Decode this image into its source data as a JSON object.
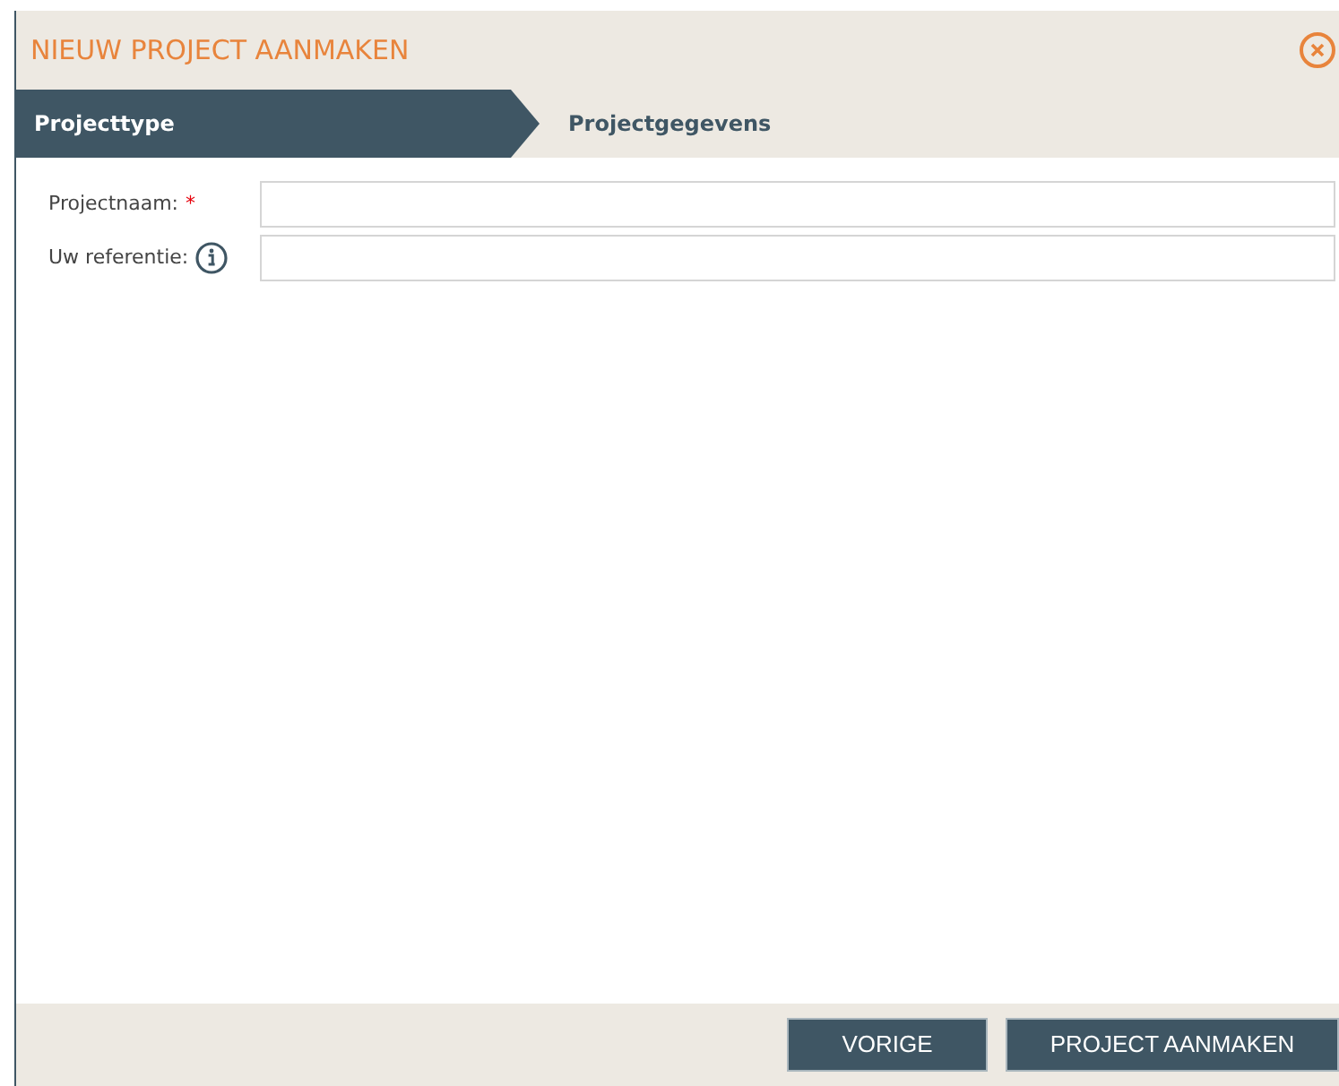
{
  "dialog": {
    "title": "NIEUW PROJECT AANMAKEN"
  },
  "steps": [
    {
      "label": "Projecttype",
      "selected": true
    },
    {
      "label": "Projectgegevens",
      "selected": false
    }
  ],
  "fields": [
    {
      "label": "Projectnaam:",
      "marker": "*"
    },
    {
      "label": "Uw referentie:",
      "info": true
    }
  ],
  "buttons": [
    "VORIGE",
    "PROJECT AANMAKEN"
  ]
}
